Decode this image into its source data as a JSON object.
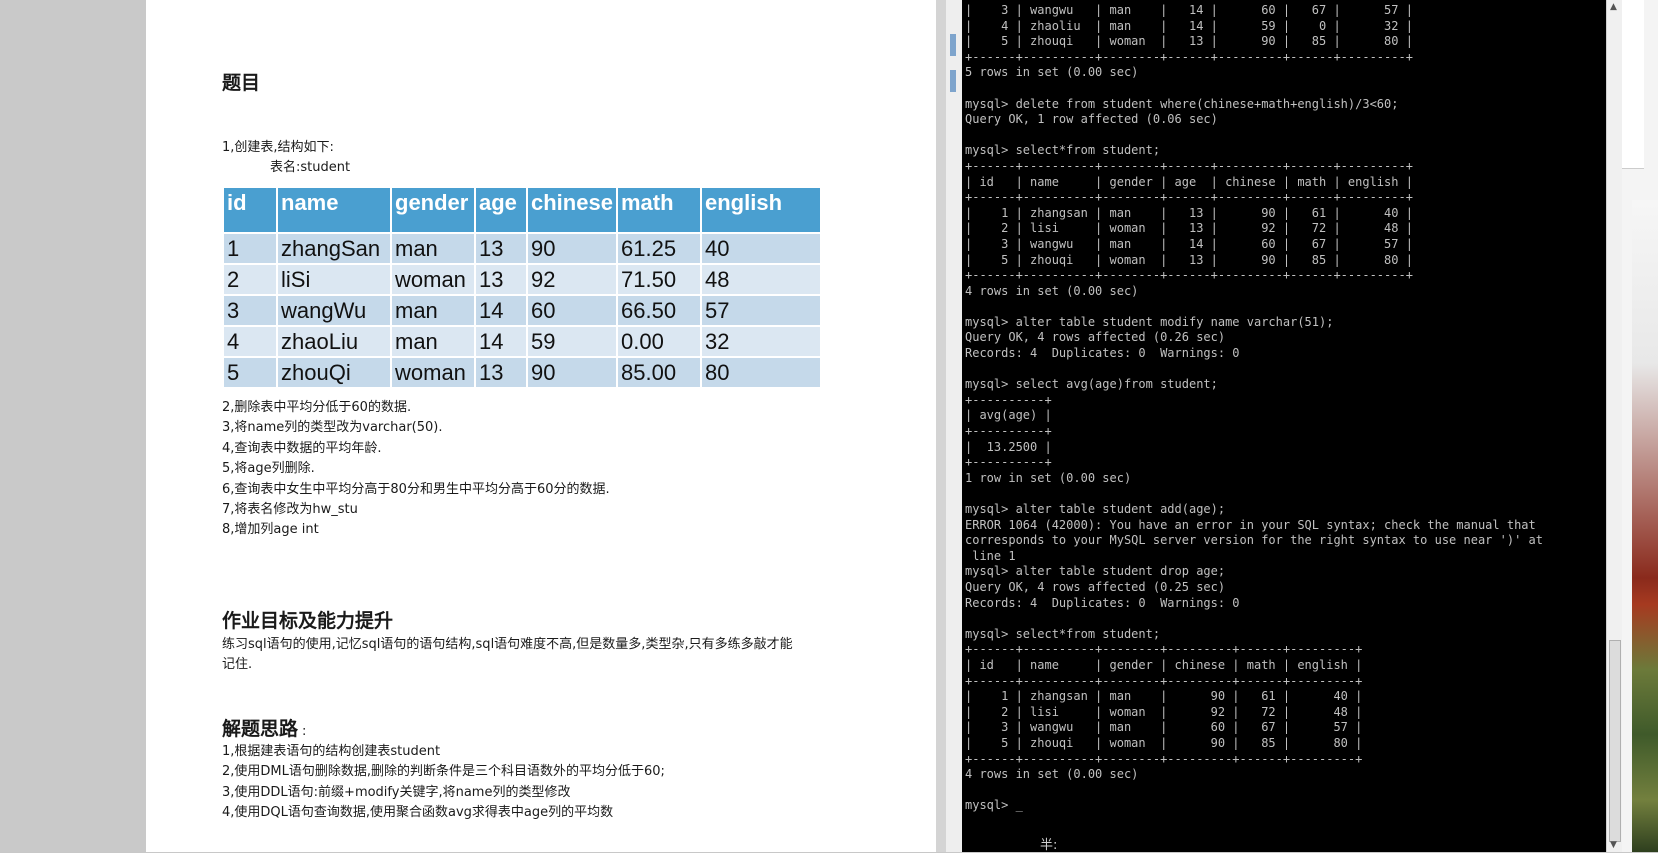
{
  "document": {
    "heading_title": "题目",
    "intro_line1": "1,创建表,结构如下:",
    "intro_line2": "表名:student",
    "table": {
      "headers": [
        "id",
        "name",
        "gender",
        "age",
        "chinese",
        "math",
        "english"
      ],
      "rows": [
        [
          "1",
          "zhangSan",
          "man",
          "13",
          "90",
          "61.25",
          "40"
        ],
        [
          "2",
          "liSi",
          "woman",
          "13",
          "92",
          "71.50",
          "48"
        ],
        [
          "3",
          "wangWu",
          "man",
          "14",
          "60",
          "66.50",
          "57"
        ],
        [
          "4",
          "zhaoLiu",
          "man",
          "14",
          "59",
          "0.00",
          "32"
        ],
        [
          "5",
          "zhouQi",
          "woman",
          "13",
          "90",
          "85.00",
          "80"
        ]
      ]
    },
    "steps": [
      "2,删除表中平均分低于60的数据.",
      "3,将name列的类型改为varchar(50).",
      "4,查询表中数据的平均年龄.",
      "5,将age列删除.",
      "6,查询表中女生中平均分高于80分和男生中平均分高于60分的数据.",
      "7,将表名修改为hw_stu",
      "8,增加列age int"
    ],
    "heading_goal": "作业目标及能力提升",
    "goal_line1": "练习sql语句的使用,记忆sql语句的语句结构,sql语句难度不高,但是数量多,类型杂,只有多练多敲才能",
    "goal_line2": "记住.",
    "heading_approach": "解题思路",
    "approach_colon": ":",
    "approach": [
      "1,根据建表语句的结构创建表student",
      "2,使用DML语句删除数据,删除的判断条件是三个科目语数外的平均分低于60;",
      "3,使用DDL语句:前缀+modify关键字,将name列的类型修改",
      "4,使用DQL语句查询数据,使用聚合函数avg求得表中age列的平均数"
    ]
  },
  "terminal": {
    "lines": [
      "|    3 | wangwu   | man    |   14 |      60 |   67 |      57 |",
      "|    4 | zhaoliu  | man    |   14 |      59 |    0 |      32 |",
      "|    5 | zhouqi   | woman  |   13 |      90 |   85 |      80 |",
      "+------+----------+--------+------+---------+------+---------+",
      "5 rows in set (0.00 sec)",
      "",
      "mysql> delete from student where(chinese+math+english)/3<60;",
      "Query OK, 1 row affected (0.06 sec)",
      "",
      "mysql> select*from student;",
      "+------+----------+--------+------+---------+------+---------+",
      "| id   | name     | gender | age  | chinese | math | english |",
      "+------+----------+--------+------+---------+------+---------+",
      "|    1 | zhangsan | man    |   13 |      90 |   61 |      40 |",
      "|    2 | lisi     | woman  |   13 |      92 |   72 |      48 |",
      "|    3 | wangwu   | man    |   14 |      60 |   67 |      57 |",
      "|    5 | zhouqi   | woman  |   13 |      90 |   85 |      80 |",
      "+------+----------+--------+------+---------+------+---------+",
      "4 rows in set (0.00 sec)",
      "",
      "mysql> alter table student modify name varchar(51);",
      "Query OK, 4 rows affected (0.26 sec)",
      "Records: 4  Duplicates: 0  Warnings: 0",
      "",
      "mysql> select avg(age)from student;",
      "+----------+",
      "| avg(age) |",
      "+----------+",
      "|  13.2500 |",
      "+----------+",
      "1 row in set (0.00 sec)",
      "",
      "mysql> alter table student add(age);",
      "ERROR 1064 (42000): You have an error in your SQL syntax; check the manual that",
      "corresponds to your MySQL server version for the right syntax to use near ')' at",
      " line 1",
      "mysql> alter table student drop age;",
      "Query OK, 4 rows affected (0.25 sec)",
      "Records: 4  Duplicates: 0  Warnings: 0",
      "",
      "mysql> select*from student;",
      "+------+----------+--------+---------+------+---------+",
      "| id   | name     | gender | chinese | math | english |",
      "+------+----------+--------+---------+------+---------+",
      "|    1 | zhangsan | man    |      90 |   61 |      40 |",
      "|    2 | lisi     | woman  |      92 |   72 |      48 |",
      "|    3 | wangwu   | man    |      60 |   67 |      57 |",
      "|    5 | zhouqi   | woman  |      90 |   85 |      80 |",
      "+------+----------+--------+---------+------+---------+",
      "4 rows in set (0.00 sec)",
      "",
      "mysql> _"
    ],
    "ime_status": "半:"
  }
}
